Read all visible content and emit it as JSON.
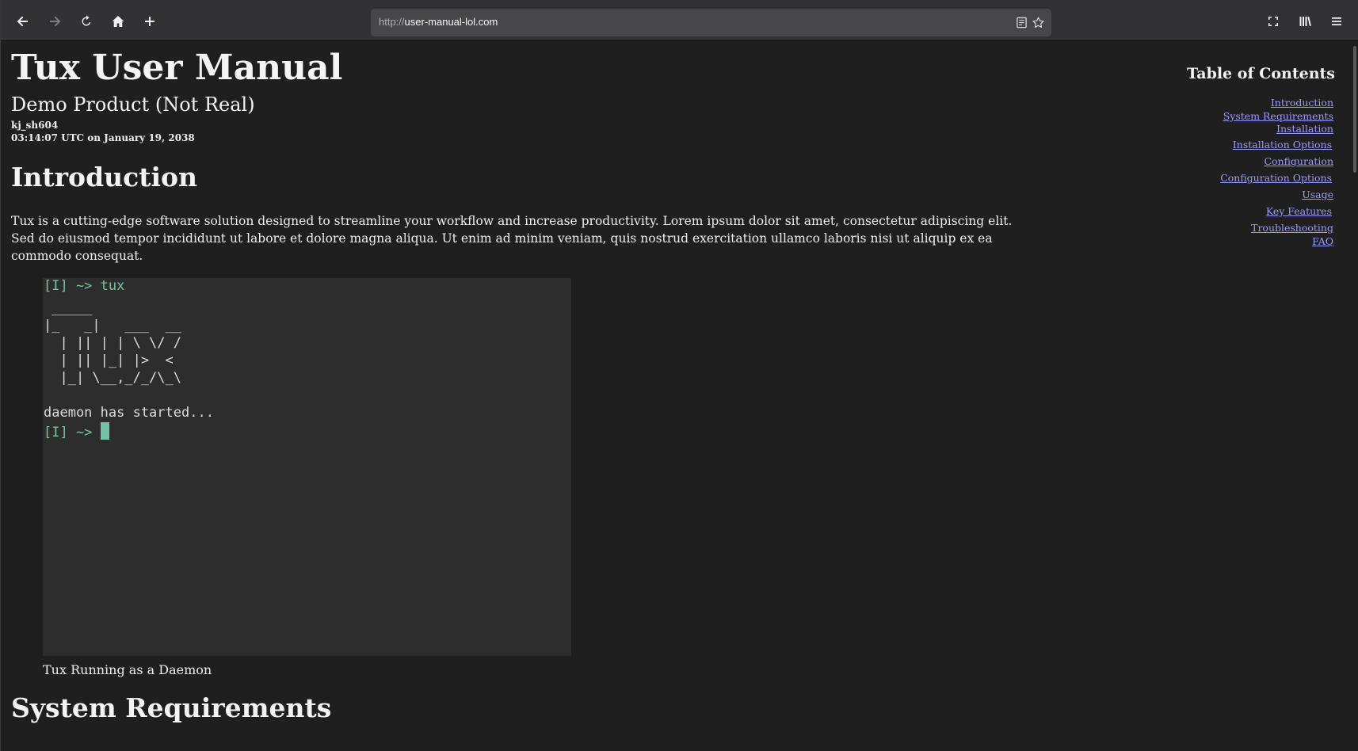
{
  "browser": {
    "url_protocol": "http://",
    "url_host": "user-manual-lol.com"
  },
  "doc": {
    "title": "Tux User Manual",
    "subtitle": "Demo Product (Not Real)",
    "author": "kj_sh604",
    "date": "03:14:07 UTC on January 19, 2038"
  },
  "intro": {
    "heading": "Introduction",
    "paragraph": "Tux is a cutting-edge software solution designed to streamline your workflow and increase productivity. Lorem ipsum dolor sit amet, consectetur adipiscing elit. Sed do eiusmod tempor incididunt ut labore et dolore magna aliqua. Ut enim ad minim veniam, quis nostrud exercitation ullamco laboris nisi ut aliquip ex ea commodo consequat."
  },
  "terminal": {
    "prompt": "[I] ~>",
    "command": "tux",
    "ascii_art": [
      " _____",
      "|_   _|   ___  __",
      "  | || | | \\ \\/ /",
      "  | || |_| |>  <",
      "  |_| \\__,_/_/\\_\\"
    ],
    "status": "daemon has started...",
    "caption": "Tux Running as a Daemon"
  },
  "next_section": {
    "heading": "System Requirements"
  },
  "toc": {
    "title": "Table of Contents",
    "links": [
      "Introduction",
      "System Requirements",
      "Installation",
      "Installation Options",
      "Configuration",
      "Configuration Options",
      "Usage",
      "Key Features",
      "Troubleshooting",
      "FAQ"
    ]
  },
  "colors": {
    "page_bg": "#1f1f1f",
    "terminal_bg": "#2d2d2d",
    "prompt_green": "#6fca9a",
    "link": "#9b9bff"
  },
  "icons": {
    "toolbar": [
      "back-icon",
      "forward-icon",
      "reload-icon",
      "home-icon",
      "new-tab-icon"
    ],
    "url": [
      "reader-view-icon",
      "bookmark-star-icon"
    ],
    "right": [
      "extensions-icon",
      "library-icon",
      "menu-icon"
    ]
  }
}
